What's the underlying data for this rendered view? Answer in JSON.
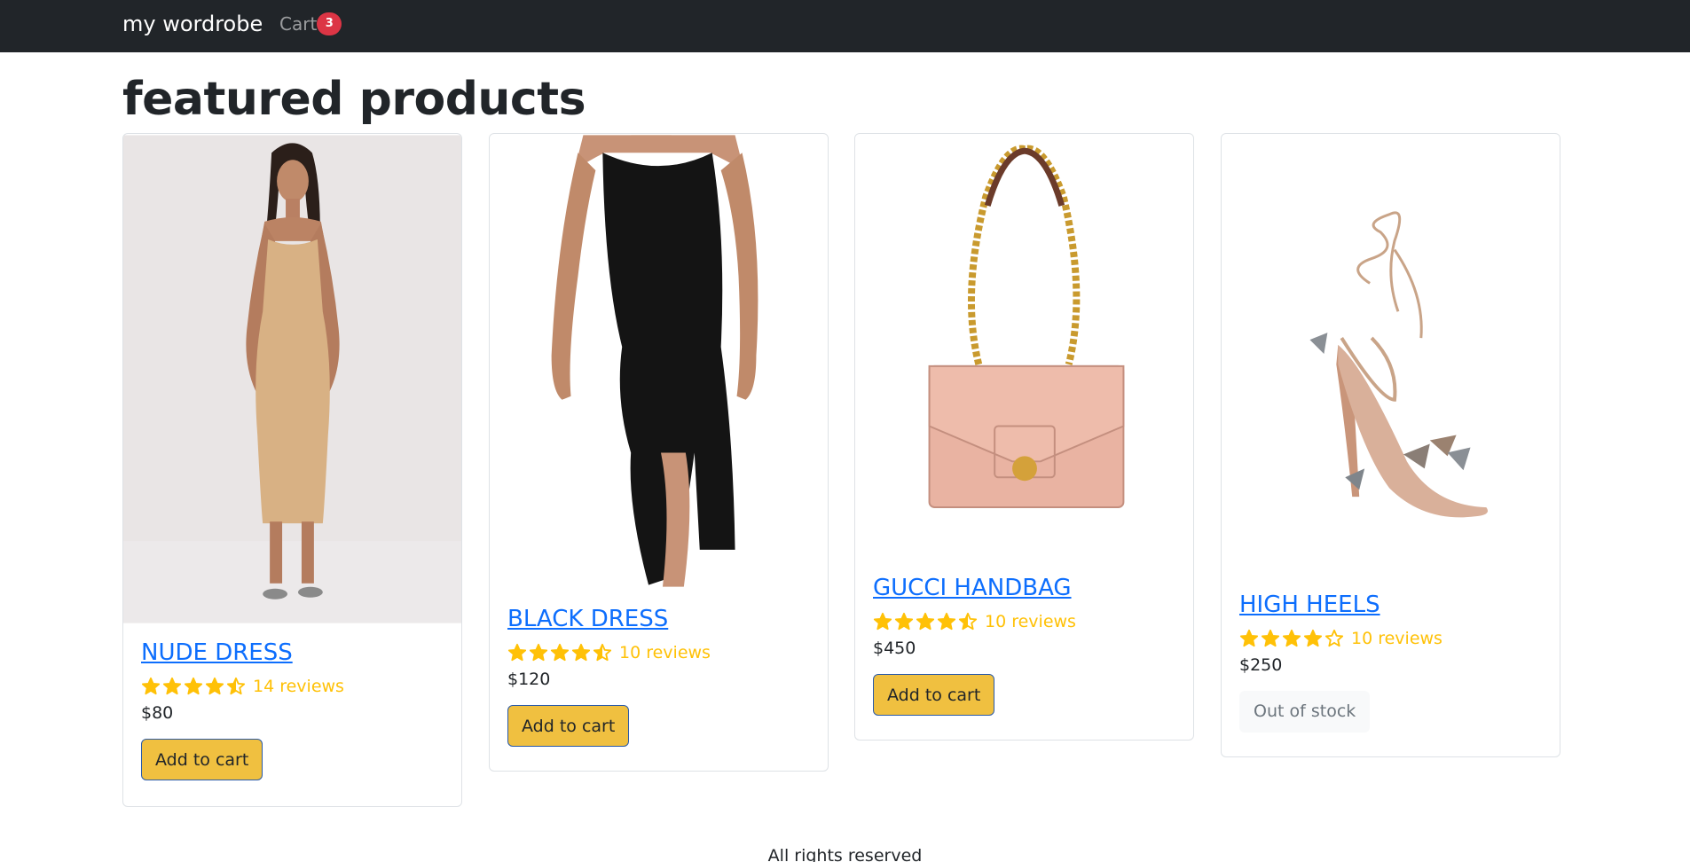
{
  "nav": {
    "brand": "my wordrobe",
    "cart_label": "Cart",
    "cart_count": "3"
  },
  "page_title": "featured products",
  "colors": {
    "navbar_bg": "#212529",
    "link": "#0d6efd",
    "star": "#ffc107",
    "button_bg": "#f0c040",
    "badge": "#dc3545"
  },
  "products": [
    {
      "name": "NUDE DRESS",
      "rating": 4.5,
      "reviews": "14 reviews",
      "price": "$80",
      "action": "Add to cart",
      "in_stock": true,
      "image": "nude-dress-image"
    },
    {
      "name": "BLACK DRESS",
      "rating": 4.5,
      "reviews": "10 reviews",
      "price": "$120",
      "action": "Add to cart",
      "in_stock": true,
      "image": "black-dress-image"
    },
    {
      "name": "GUCCI HANDBAG",
      "rating": 4.5,
      "reviews": "10 reviews",
      "price": "$450",
      "action": "Add to cart",
      "in_stock": true,
      "image": "handbag-image"
    },
    {
      "name": "HIGH HEELS",
      "rating": 4,
      "reviews": "10 reviews",
      "price": "$250",
      "action": "Out of stock",
      "in_stock": false,
      "image": "high-heels-image"
    }
  ],
  "footer": "All rights reserved"
}
